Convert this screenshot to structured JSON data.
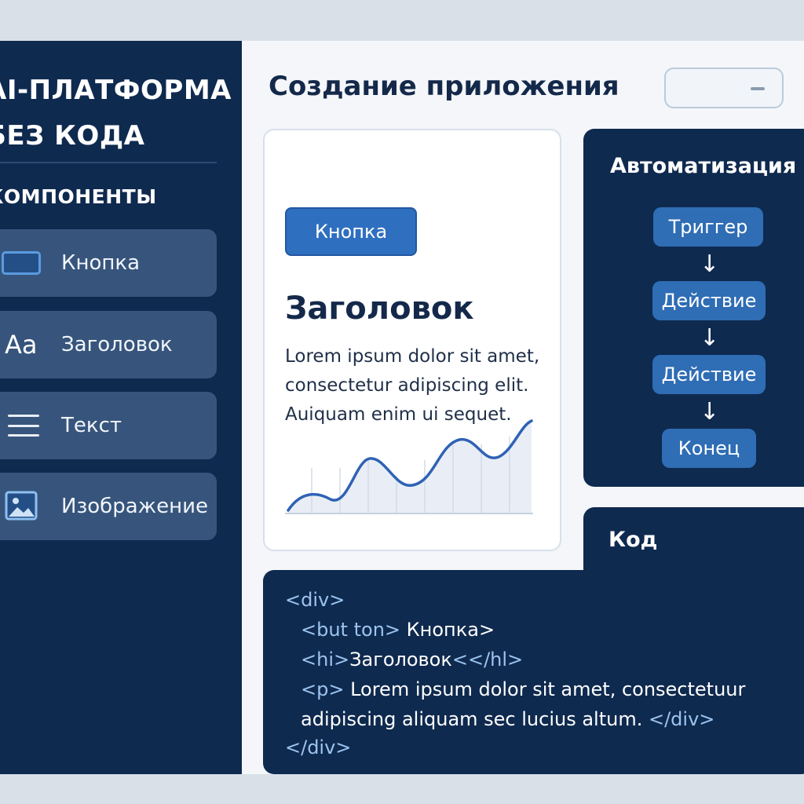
{
  "sidebar": {
    "brand": "AI-ПЛАТФОРМА\nБЕЗ КОДА",
    "section": "КОМПОНЕНТЫ",
    "items": [
      {
        "label": "Кнопка",
        "icon": "button-icon"
      },
      {
        "label": "Заголовок",
        "icon": "heading-icon",
        "glyph": "Aa"
      },
      {
        "label": "Текст",
        "icon": "text-lines-icon"
      },
      {
        "label": "Изображение",
        "icon": "image-icon"
      }
    ]
  },
  "header": {
    "title": "Создание приложения"
  },
  "preview": {
    "button_label": "Кнопка",
    "heading": "Заголовок",
    "paragraph": "Lorem ipsum dolor sit amet, consectetur adipiscing elit. Auiquam enim ui sequet."
  },
  "automation": {
    "title": "Автоматизация",
    "nodes": [
      "Триггер",
      "Действие",
      "Действие",
      "Конец"
    ]
  },
  "code": {
    "title": "Код",
    "lines": [
      {
        "tag": "<div>",
        "text": ""
      },
      {
        "tag": "<but ton>",
        "text": " Кнопка>"
      },
      {
        "tag": "<hi>",
        "text": "Заголовок",
        "tag2": "<</hl>"
      },
      {
        "tag": "<p>",
        "text": " Lorem ipsum dolor sit amet, consectetuur"
      },
      {
        "tag": "",
        "text": "adipiscing aliquam sec lucius altum.",
        "tag2": " </div>"
      },
      {
        "tag": "</div>",
        "text": ""
      }
    ]
  },
  "colors": {
    "navy": "#0f2a4f",
    "accent": "#2f6fbf",
    "sidebar_item": "#37557c",
    "chart_line": "#2f62b5"
  }
}
